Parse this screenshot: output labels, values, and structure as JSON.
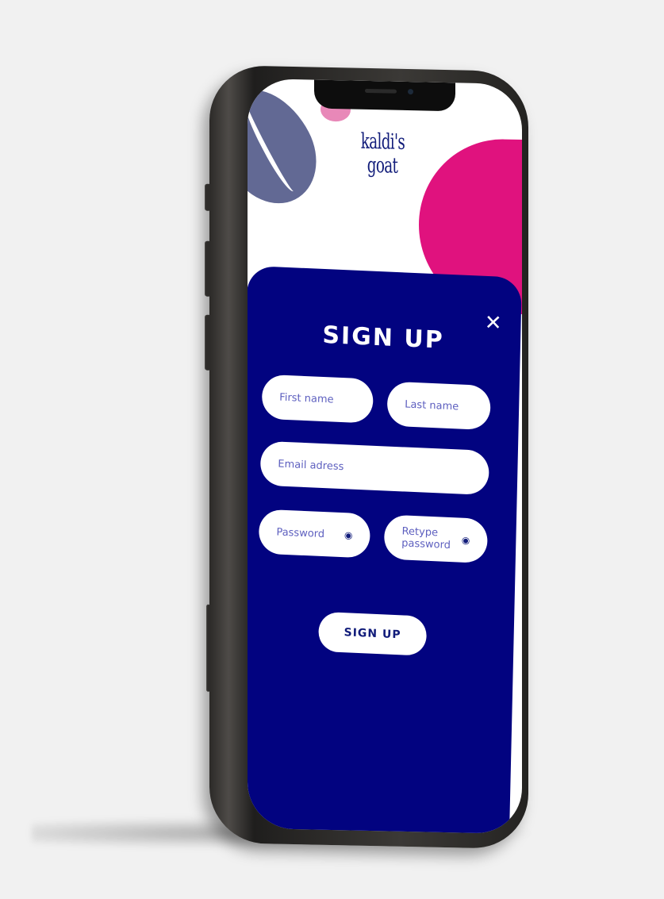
{
  "app": {
    "logo_line1": "kaldi's",
    "logo_line2": "goat"
  },
  "modal": {
    "title": "SIGN UP",
    "close_label": "✕",
    "fields": {
      "first_name": {
        "placeholder": "First name"
      },
      "last_name": {
        "placeholder": "Last name"
      },
      "email": {
        "placeholder": "Email adress"
      },
      "password": {
        "placeholder": "Password",
        "icon": "eye-icon"
      },
      "retype_password": {
        "placeholder": "Retype password",
        "icon": "eye-icon"
      }
    },
    "submit_label": "SIGN UP"
  },
  "colors": {
    "panel": "#020380",
    "accent_pink": "#e0127e",
    "bean": "#626994",
    "text_dark": "#111c7a",
    "placeholder": "#5d5fbf"
  }
}
